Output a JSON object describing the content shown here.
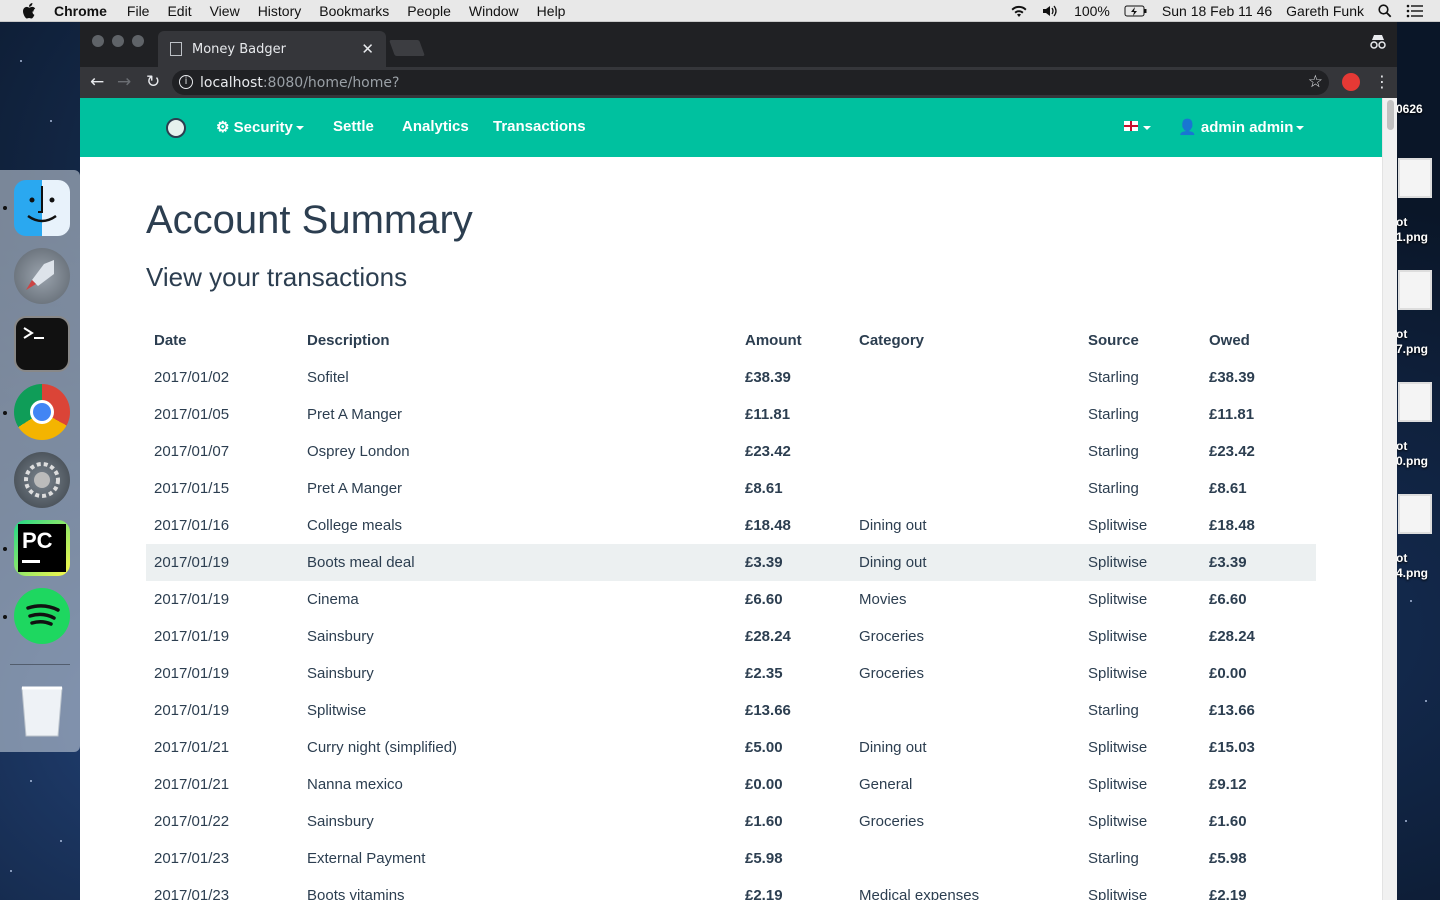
{
  "menubar": {
    "app": "Chrome",
    "items": [
      "File",
      "Edit",
      "View",
      "History",
      "Bookmarks",
      "People",
      "Window",
      "Help"
    ],
    "battery": "100%",
    "clock": "Sun 18 Feb  11 46",
    "user": "Gareth Funk"
  },
  "desktop_files": [
    {
      "line1": "0626",
      "line2": ""
    },
    {
      "line1": "ot",
      "line2": "1.png"
    },
    {
      "line1": "ot",
      "line2": "7.png"
    },
    {
      "line1": "ot",
      "line2": "0.png"
    },
    {
      "line1": "ot",
      "line2": "4.png"
    }
  ],
  "browser": {
    "tab_title": "Money Badger",
    "url_host": "localhost",
    "url_path": ":8080/home/home?"
  },
  "navbar": {
    "security": "Security",
    "settle": "Settle",
    "analytics": "Analytics",
    "transactions": "Transactions",
    "user": "admin admin"
  },
  "page": {
    "title": "Account Summary",
    "subtitle": "View your transactions"
  },
  "table": {
    "headers": [
      "Date",
      "Description",
      "Amount",
      "Category",
      "Source",
      "Owed"
    ],
    "rows": [
      {
        "date": "2017/01/02",
        "desc": "Sofitel",
        "amount": "£38.39",
        "category": "",
        "source": "Starling",
        "owed": "£38.39"
      },
      {
        "date": "2017/01/05",
        "desc": "Pret A Manger",
        "amount": "£11.81",
        "category": "",
        "source": "Starling",
        "owed": "£11.81"
      },
      {
        "date": "2017/01/07",
        "desc": "Osprey London",
        "amount": "£23.42",
        "category": "",
        "source": "Starling",
        "owed": "£23.42"
      },
      {
        "date": "2017/01/15",
        "desc": "Pret A Manger",
        "amount": "£8.61",
        "category": "",
        "source": "Starling",
        "owed": "£8.61"
      },
      {
        "date": "2017/01/16",
        "desc": "College meals",
        "amount": "£18.48",
        "category": "Dining out",
        "source": "Splitwise",
        "owed": "£18.48"
      },
      {
        "date": "2017/01/19",
        "desc": "Boots meal deal",
        "amount": "£3.39",
        "category": "Dining out",
        "source": "Splitwise",
        "owed": "£3.39"
      },
      {
        "date": "2017/01/19",
        "desc": "Cinema",
        "amount": "£6.60",
        "category": "Movies",
        "source": "Splitwise",
        "owed": "£6.60"
      },
      {
        "date": "2017/01/19",
        "desc": "Sainsbury",
        "amount": "£28.24",
        "category": "Groceries",
        "source": "Splitwise",
        "owed": "£28.24"
      },
      {
        "date": "2017/01/19",
        "desc": "Sainsbury",
        "amount": "£2.35",
        "category": "Groceries",
        "source": "Splitwise",
        "owed": "£0.00"
      },
      {
        "date": "2017/01/19",
        "desc": "Splitwise",
        "amount": "£13.66",
        "category": "",
        "source": "Starling",
        "owed": "£13.66"
      },
      {
        "date": "2017/01/21",
        "desc": "Curry night (simplified)",
        "amount": "£5.00",
        "category": "Dining out",
        "source": "Splitwise",
        "owed": "£15.03"
      },
      {
        "date": "2017/01/21",
        "desc": "Nanna mexico",
        "amount": "£0.00",
        "category": "General",
        "source": "Splitwise",
        "owed": "£9.12"
      },
      {
        "date": "2017/01/22",
        "desc": "Sainsbury",
        "amount": "£1.60",
        "category": "Groceries",
        "source": "Splitwise",
        "owed": "£1.60"
      },
      {
        "date": "2017/01/23",
        "desc": "External Payment",
        "amount": "£5.98",
        "category": "",
        "source": "Starling",
        "owed": "£5.98"
      },
      {
        "date": "2017/01/23",
        "desc": "Boots vitamins",
        "amount": "£2.19",
        "category": "Medical expenses",
        "source": "Splitwise",
        "owed": "£2.19"
      }
    ]
  },
  "colors": {
    "navbar": "#00c19f",
    "text": "#2c3e50",
    "row_hover": "#ecf0f1"
  }
}
